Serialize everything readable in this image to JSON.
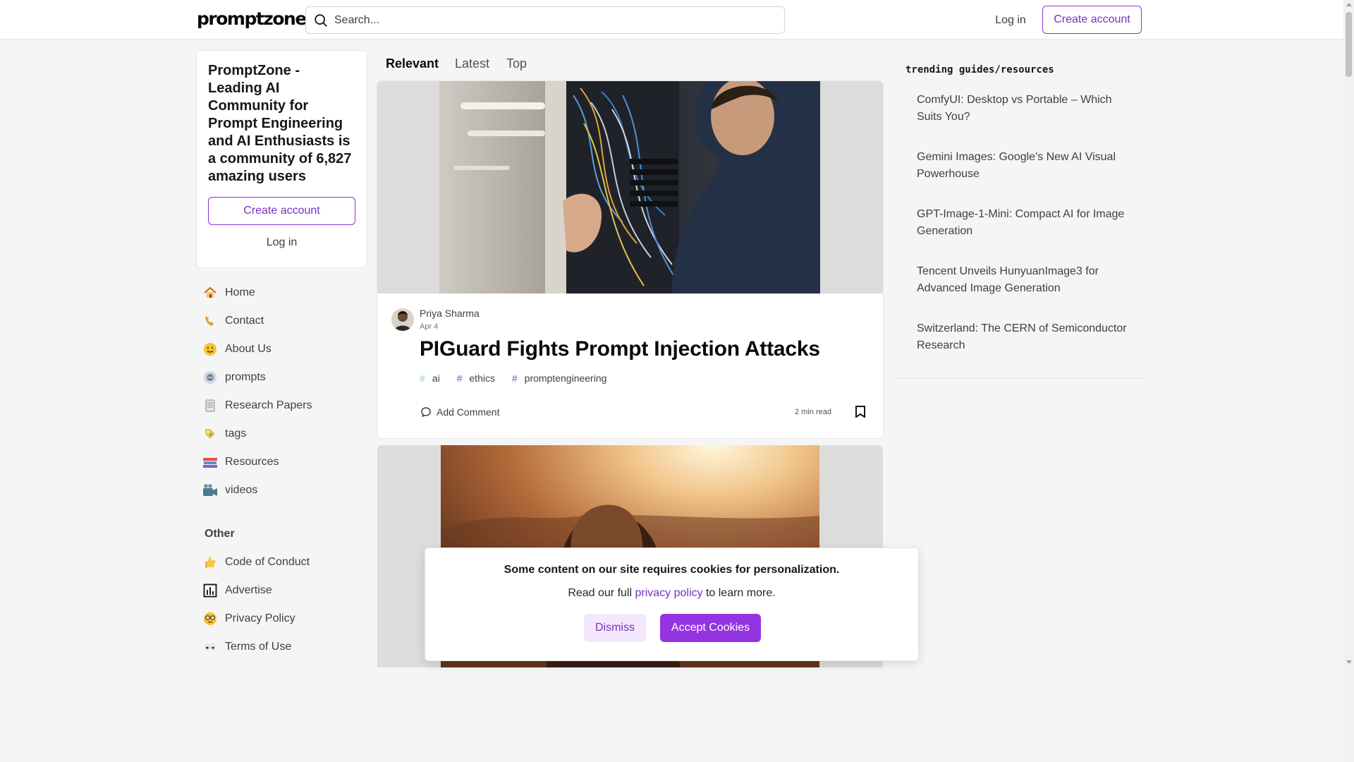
{
  "header": {
    "logo": "promptzone.",
    "search_placeholder": "Search...",
    "login_label": "Log in",
    "create_account_label": "Create account"
  },
  "welcome": {
    "headline": "PromptZone - Leading AI Community for Prompt Engineering and AI Enthusiasts is a community of 6,827 amazing users",
    "create_account_label": "Create account",
    "login_label": "Log in"
  },
  "nav": {
    "items": [
      {
        "label": "Home",
        "icon": "house-icon"
      },
      {
        "label": "Contact",
        "icon": "telephone-icon"
      },
      {
        "label": "About Us",
        "icon": "smiley-icon"
      },
      {
        "label": "prompts",
        "icon": "prompts-icon"
      },
      {
        "label": "Research Papers",
        "icon": "document-icon"
      },
      {
        "label": "tags",
        "icon": "tag-icon"
      },
      {
        "label": "Resources",
        "icon": "books-icon"
      },
      {
        "label": "videos",
        "icon": "camera-icon"
      }
    ],
    "other_heading": "Other",
    "other_items": [
      {
        "label": "Code of Conduct",
        "icon": "thumbs-up-icon"
      },
      {
        "label": "Advertise",
        "icon": "chart-icon"
      },
      {
        "label": "Privacy Policy",
        "icon": "nerd-face-icon"
      },
      {
        "label": "Terms of Use",
        "icon": "eyes-icon"
      }
    ]
  },
  "feed": {
    "tabs": [
      "Relevant",
      "Latest",
      "Top"
    ],
    "active_tab": "Relevant",
    "post": {
      "author": "Priya Sharma",
      "date": "Apr 4",
      "title": "PIGuard Fights Prompt Injection Attacks",
      "tags": [
        {
          "hash": "#",
          "name": "ai"
        },
        {
          "hash": "#",
          "name": "ethics"
        },
        {
          "hash": "#",
          "name": "promptengineering"
        }
      ],
      "add_comment_label": "Add Comment",
      "read_time": "2 min read"
    }
  },
  "trending": {
    "title": "trending guides/resources",
    "items": [
      "ComfyUI: Desktop vs Portable – Which Suits You?",
      "Gemini Images: Google's New AI Visual Powerhouse",
      "GPT-Image-1-Mini: Compact AI for Image Generation",
      "Tencent Unveils HunyuanImage3 for Advanced Image Generation",
      "Switzerland: The CERN of Semiconductor Research"
    ]
  },
  "cookie": {
    "title": "Some content on our site requires cookies for personalization.",
    "text_before": "Read our full ",
    "link": "privacy policy",
    "text_after": " to learn more.",
    "dismiss_label": "Dismiss",
    "accept_label": "Accept Cookies"
  },
  "colors": {
    "accent": "#9334e0",
    "accent_text": "#7a2fc0",
    "background": "#f5f5f5"
  }
}
